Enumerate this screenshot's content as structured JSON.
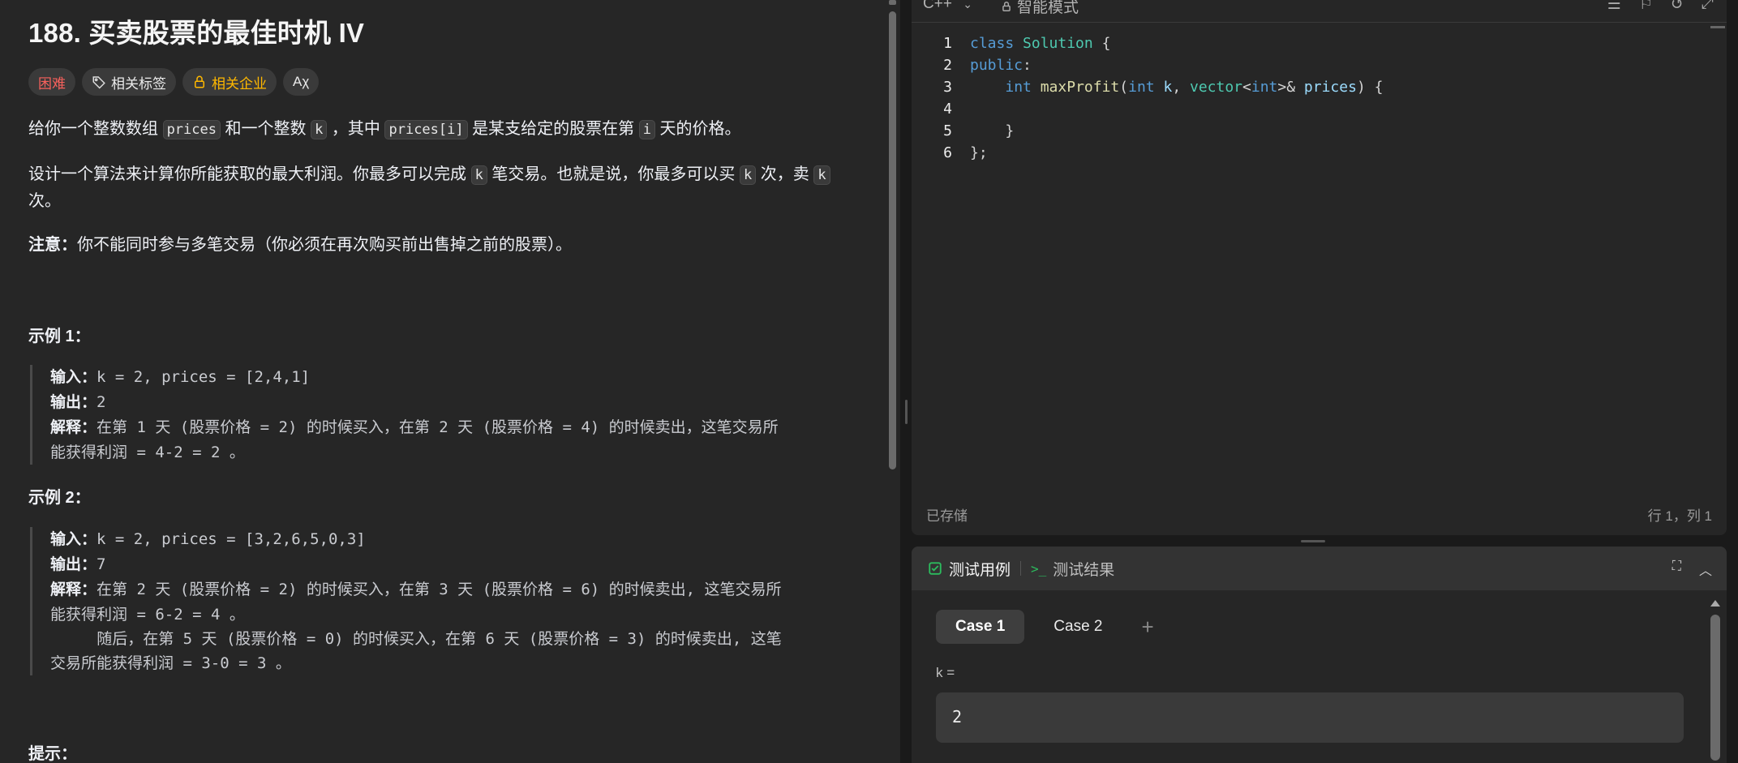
{
  "problem": {
    "title": "188. 买卖股票的最佳时机 IV",
    "tags": {
      "difficulty": "困难",
      "related_tags": "相关标签",
      "related_companies": "相关企业",
      "translate": "Aχ"
    },
    "p1": {
      "t1": "给你一个整数数组 ",
      "c1": "prices",
      "t2": " 和一个整数 ",
      "c2": "k",
      "t3": " ，其中 ",
      "c3": "prices[i]",
      "t4": " 是某支给定的股票在第 ",
      "c4": "i",
      "t5": " 天的价格。"
    },
    "p2": {
      "t1": "设计一个算法来计算你所能获取的最大利润。你最多可以完成 ",
      "c1": "k",
      "t2": " 笔交易。也就是说，你最多可以买 ",
      "c2": "k",
      "t3": " 次，卖 ",
      "c3": "k",
      "t4": " 次。"
    },
    "note": {
      "label": "注意：",
      "text": "你不能同时参与多笔交易（你必须在再次购买前出售掉之前的股票）。"
    },
    "example1": {
      "title": "示例 1：",
      "input_label": "输入：",
      "input": "k = 2, prices = [2,4,1]",
      "output_label": "输出：",
      "output": "2",
      "explain_label": "解释：",
      "explain_line1": "在第 1 天 (股票价格 = 2) 的时候买入，在第 2 天 (股票价格 = 4) 的时候卖出，这笔交易所",
      "explain_line2": "能获得利润 = 4-2 = 2 。"
    },
    "example2": {
      "title": "示例 2：",
      "input_label": "输入：",
      "input": "k = 2, prices = [3,2,6,5,0,3]",
      "output_label": "输出：",
      "output": "7",
      "explain_label": "解释：",
      "explain_line1": "在第 2 天 (股票价格 = 2) 的时候买入，在第 3 天 (股票价格 = 6) 的时候卖出, 这笔交易所",
      "explain_line2": "能获得利润 = 6-2 = 4 。",
      "explain_line3": "     随后，在第 5 天 (股票价格 = 0) 的时候买入，在第 6 天 (股票价格 = 3) 的时候卖出, 这笔",
      "explain_line4": "交易所能获得利润 = 3-0 = 3 。"
    },
    "hints_title": "提示："
  },
  "editor": {
    "language": "C++",
    "mode": "智能模式",
    "line_numbers": [
      "1",
      "2",
      "3",
      "4",
      "5",
      "6"
    ],
    "saved_status": "已存储",
    "cursor_pos": "行 1，列 1"
  },
  "testcase": {
    "tab_cases": "测试用例",
    "tab_results": "测试结果",
    "case1": "Case 1",
    "case2": "Case 2",
    "add": "+",
    "var_label": "k =",
    "var_value": "2"
  },
  "colors": {
    "hard": "#f8615c",
    "company": "#ffb800",
    "keyword": "#569cd6",
    "type": "#4ec9b0",
    "function": "#dcdcaa",
    "check": "#2cbb5d"
  }
}
